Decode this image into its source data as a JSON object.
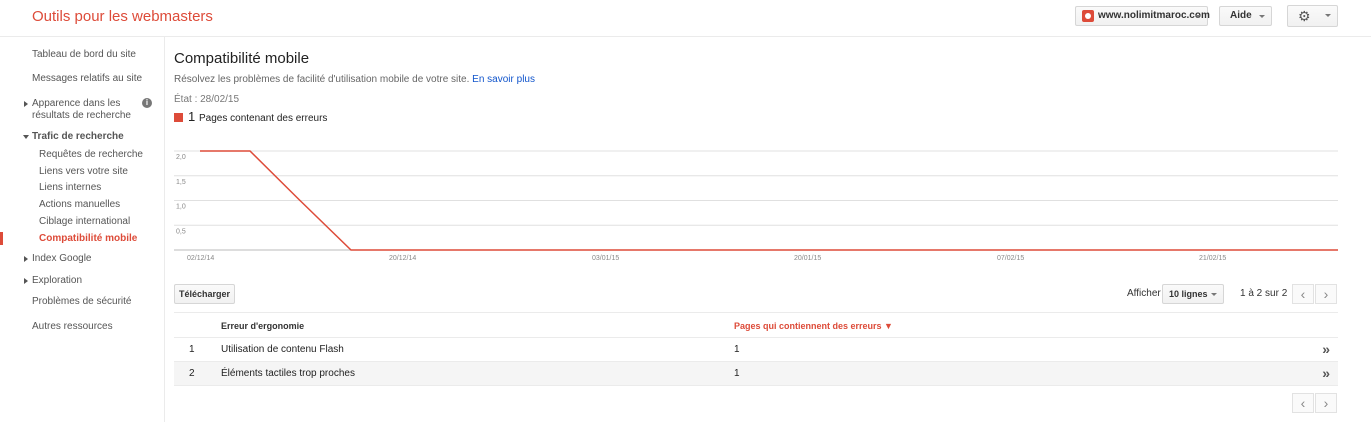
{
  "header": {
    "app_title": "Outils pour les webmasters",
    "site": "www.nolimitmaroc.com",
    "help_label": "Aide",
    "settings_icon": "gear-icon"
  },
  "sidebar": {
    "items": [
      {
        "label": "Tableau de bord du site"
      },
      {
        "label": "Messages relatifs au site"
      },
      {
        "label_line1": "Apparence dans les",
        "label_line2": "résultats de recherche",
        "info_icon": "i"
      },
      {
        "label": "Trafic de recherche"
      },
      {
        "label": "Index Google"
      },
      {
        "label": "Exploration"
      },
      {
        "label": "Problèmes de sécurité"
      },
      {
        "label": "Autres ressources"
      }
    ],
    "subitems": [
      {
        "label": "Requêtes de recherche"
      },
      {
        "label": "Liens vers votre site"
      },
      {
        "label": "Liens internes"
      },
      {
        "label": "Actions manuelles"
      },
      {
        "label": "Ciblage international"
      },
      {
        "label": "Compatibilité mobile"
      }
    ]
  },
  "main": {
    "title": "Compatibilité mobile",
    "subtitle": "Résolvez les problèmes de facilité d'utilisation mobile de votre site.",
    "learn_more": "En savoir plus",
    "status": "État : 28/02/15",
    "legend_count": "1",
    "legend_label": "Pages contenant des erreurs",
    "accent_color": "#dd4b39"
  },
  "chart_data": {
    "type": "line",
    "x": [
      "02/12/14",
      "06/12/14",
      "10/12/14",
      "14/12/14",
      "20/12/14",
      "03/01/15",
      "20/01/15",
      "07/02/15",
      "21/02/15",
      "28/02/15"
    ],
    "series": [
      {
        "name": "Pages contenant des erreurs",
        "values": [
          2,
          2,
          2,
          1,
          0,
          0,
          0,
          0,
          0,
          0
        ],
        "color": "#dd4b39"
      }
    ],
    "x_tick_labels": [
      "02/12/14",
      "20/12/14",
      "03/01/15",
      "20/01/15",
      "07/02/15",
      "21/02/15"
    ],
    "y_tick_labels": [
      "2,0",
      "1,5",
      "1,0",
      "0,5"
    ],
    "ylim": [
      0,
      2
    ],
    "grid": true
  },
  "controls": {
    "download_label": "Télécharger",
    "show_label": "Afficher",
    "rows_value": "10 lignes",
    "page_info": "1 à 2 sur 2",
    "prev_icon": "‹",
    "next_icon": "›"
  },
  "table": {
    "headers": [
      "Erreur d'ergonomie",
      "Pages qui contiennent des erreurs ▼"
    ],
    "rows": [
      {
        "index": "1",
        "error": "Utilisation de contenu Flash",
        "pages": "1",
        "arrow": "»"
      },
      {
        "index": "2",
        "error": "Éléments tactiles trop proches",
        "pages": "1",
        "arrow": "»"
      }
    ]
  }
}
